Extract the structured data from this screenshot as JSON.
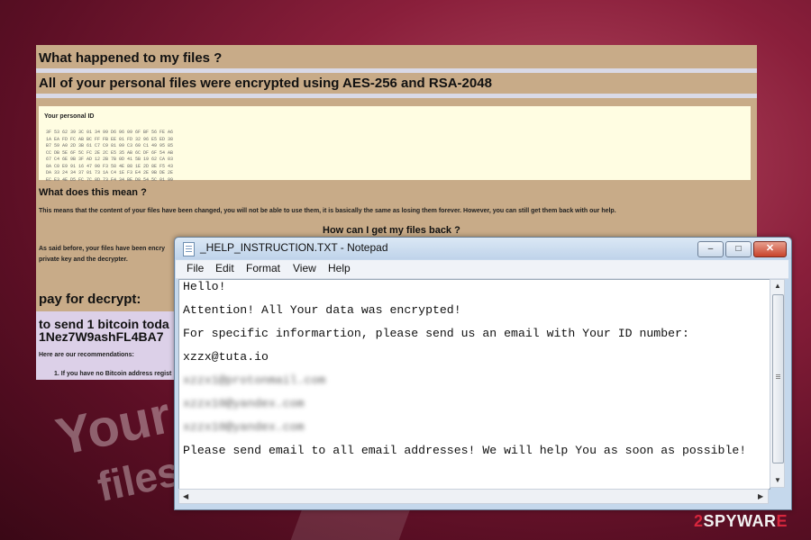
{
  "background": {
    "word1": "Your",
    "word2": "files"
  },
  "ransom_page": {
    "heading1": "What happened to my files ?",
    "heading2": "All of your personal files were encrypted using AES-256 and RSA-2048",
    "personal_id_label": "Your personal ID",
    "personal_id_hex": "3F 53 62 39 3C 01 34 99 D6 96 09 6F BF 56 FE A6\n1A EA FD FC AB BC FF FB EE 01 FD 32 96 E5 ED 38\nB7 59 A0 2D 3B 61 C7 C9 81 09 C3 60 C1 49 95 85\nCC DB 5E 6F 5C FC 2E 2C E5 35 AB 6C DF 6F 54 AB\n67 C4 6E 9B 3F AD 12 2B 7B 0D 41 5B 19 62 CA 03\n8A C0 E9 91 16 47 90 F3 58 4E 88 1E 2D 8E F5 43\nDA 33 24 34 37 01 73 1A C4 1E F3 E4 2E 9B DE 2E\nEC E3 4E D5 FC 7C 8D 73 F4 34 BE D8 54 5C 01 99",
    "what_mean_heading": "What does this mean ?",
    "what_mean_text": "This means that the content of your files have been changed, you will not be able to use them, it is basically the same as losing them forever. However, you can still get them back with our help.",
    "how_back_heading": "How can I get my files back ?",
    "as_said_text": "As said before, your files have been encry",
    "private_key_text": "private key and the decrypter.",
    "pay_heading": "pay for decrypt:",
    "pay_line1": "to send 1 bitcoin toda",
    "pay_line2": "1Nez7W9ashFL4BA7",
    "recommendations_label": "Here are our recommendations:",
    "recommendation_1": "1.  If you have no Bitcoin address regist"
  },
  "notepad": {
    "title": "_HELP_INSTRUCTION.TXT - Notepad",
    "menu": [
      "File",
      "Edit",
      "Format",
      "View",
      "Help"
    ],
    "lines": [
      "Hello!",
      "Attention! All Your data was encrypted!",
      "For specific informartion, please send us an email with Your ID number:",
      "xzzx@tuta.io",
      "xzzx1@protonmail.com",
      "xzzx10@yandex.com",
      "xzzx10@yandex.com",
      "Please send email to all email addresses! We will help You as soon as possible!"
    ],
    "buttons": {
      "minimize": "–",
      "maximize": "□",
      "close": "✕"
    }
  },
  "watermark": {
    "prefix": "2",
    "main": "SPYWAR",
    "suffix": "E"
  }
}
